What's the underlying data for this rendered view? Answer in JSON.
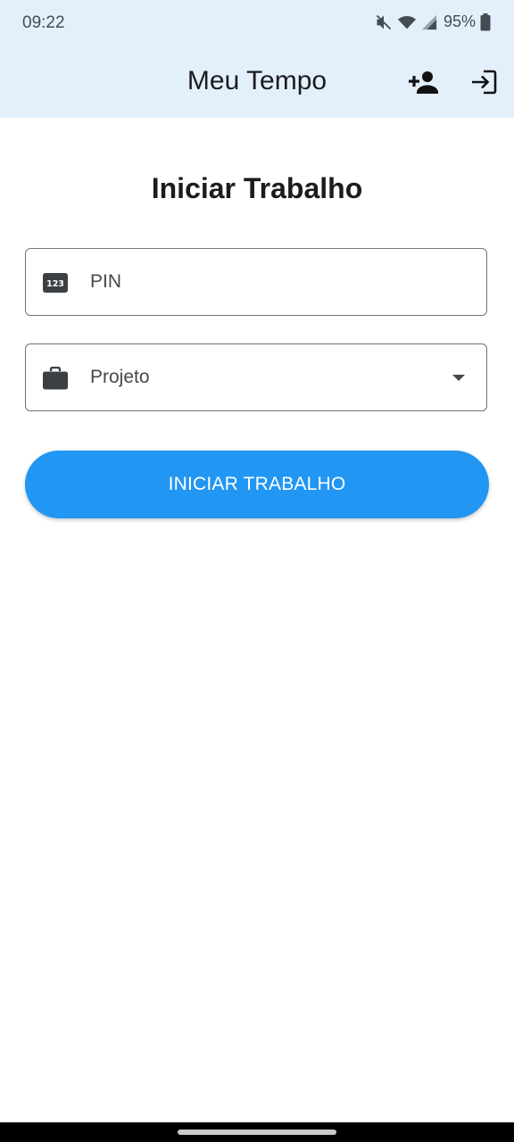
{
  "status_bar": {
    "time": "09:22",
    "battery_percent": "95%",
    "icons": [
      "mute-icon",
      "wifi-icon",
      "signal-icon",
      "battery-icon"
    ]
  },
  "app_bar": {
    "title": "Meu Tempo",
    "actions": [
      "person-add-icon",
      "login-icon"
    ]
  },
  "main": {
    "heading": "Iniciar Trabalho",
    "pin_field": {
      "label": "PIN",
      "icon": "pin-123-icon"
    },
    "project_field": {
      "label": "Projeto",
      "icon": "briefcase-icon"
    },
    "start_button": {
      "label": "INICIAR TRABALHO"
    }
  },
  "colors": {
    "app_bar_bg": "#e3f0fc",
    "primary": "#2196f3",
    "text_dark": "#1b1b1f",
    "field_border": "#6f7479"
  }
}
